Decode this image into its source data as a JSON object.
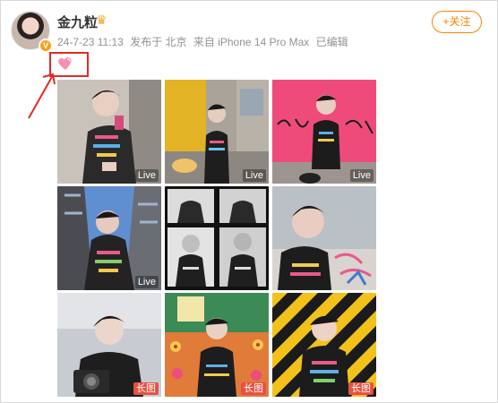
{
  "post": {
    "username": "金九粒",
    "crown_icon": "crown-icon",
    "meta": {
      "date": "24-7-23 11:13",
      "published_at": "发布于 北京",
      "device": "来自 iPhone 14 Pro Max",
      "edited": "已编辑"
    },
    "follow_label": "+关注",
    "emoji_icon": "pink-heart-emoji"
  },
  "colors": {
    "accent": "#ff8200",
    "annotation_red": "#e42a24",
    "long_badge": "#e8503f"
  },
  "photos": [
    {
      "badge": "Live",
      "badge_type": "live",
      "scene": "selfie-indoor"
    },
    {
      "badge": "Live",
      "badge_type": "live",
      "scene": "street-yellow-wall"
    },
    {
      "badge": "Live",
      "badge_type": "live",
      "scene": "pink-mural"
    },
    {
      "badge": "Live",
      "badge_type": "live",
      "scene": "low-angle-buildings"
    },
    {
      "badge": "",
      "badge_type": "none",
      "scene": "photo-booth-strip"
    },
    {
      "badge": "",
      "badge_type": "none",
      "scene": "selfie-graffiti"
    },
    {
      "badge": "长图",
      "badge_type": "long",
      "scene": "camera-portrait"
    },
    {
      "badge": "长图",
      "badge_type": "long",
      "scene": "flower-wall"
    },
    {
      "badge": "长图",
      "badge_type": "long",
      "scene": "hazard-stripes"
    }
  ]
}
